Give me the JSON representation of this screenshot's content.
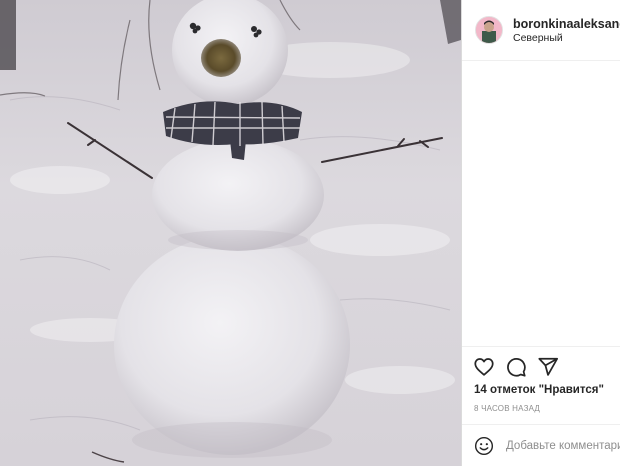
{
  "post": {
    "username": "boronkinaaleksand",
    "username_separator": "•",
    "location": "Северный",
    "likes_text": "14 отметок \"Нравится\"",
    "time_ago": "8 ЧАСОВ НАЗАД",
    "comment_placeholder": "Добавьте комментарий..."
  },
  "icons": {
    "like": "heart-icon",
    "comment": "comment-icon",
    "share": "paper-plane-icon",
    "emoji": "smiley-icon"
  },
  "colors": {
    "text": "#262626",
    "secondary_text": "#8e8e8e",
    "border": "#efefef"
  }
}
